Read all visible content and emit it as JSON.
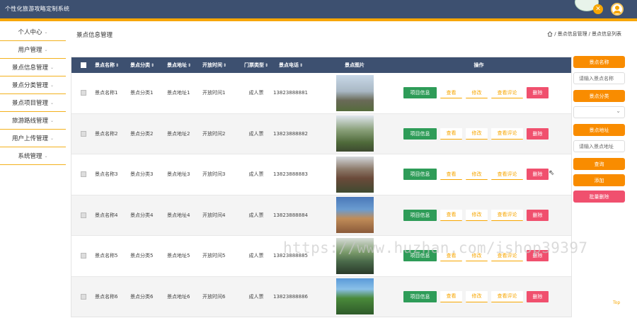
{
  "header": {
    "app_title": "个性化旅游攻略定制系统"
  },
  "sidebar": {
    "items": [
      {
        "label": "个人中心"
      },
      {
        "label": "用户管理"
      },
      {
        "label": "景点信息管理"
      },
      {
        "label": "景点分类管理"
      },
      {
        "label": "景点项目管理"
      },
      {
        "label": "旅游路线管理"
      },
      {
        "label": "用户上传管理"
      },
      {
        "label": "系统管理"
      }
    ]
  },
  "page": {
    "title": "景点信息管理",
    "breadcrumb": [
      "景点信息管理",
      "景点信息列表"
    ]
  },
  "table": {
    "headers": {
      "name": "景点名称",
      "category": "景点分类",
      "address": "景点地址",
      "open_time": "开放时间",
      "ticket": "门票类型",
      "phone": "景点电话",
      "image": "景点图片",
      "ops": "操作"
    },
    "actions": {
      "project": "项目信息",
      "view": "查看",
      "edit": "修改",
      "reviews": "查看评论",
      "delete": "删除"
    },
    "rows": [
      {
        "name": "景点名称1",
        "category": "景点分类1",
        "address": "景点地址1",
        "open_time": "开放时间1",
        "ticket": "成人票",
        "phone": "13823888881"
      },
      {
        "name": "景点名称2",
        "category": "景点分类2",
        "address": "景点地址2",
        "open_time": "开放时间2",
        "ticket": "成人票",
        "phone": "13823888882"
      },
      {
        "name": "景点名称3",
        "category": "景点分类3",
        "address": "景点地址3",
        "open_time": "开放时间3",
        "ticket": "成人票",
        "phone": "13823888883"
      },
      {
        "name": "景点名称4",
        "category": "景点分类4",
        "address": "景点地址4",
        "open_time": "开放时间4",
        "ticket": "成人票",
        "phone": "13823888884"
      },
      {
        "name": "景点名称5",
        "category": "景点分类5",
        "address": "景点地址5",
        "open_time": "开放时间5",
        "ticket": "成人票",
        "phone": "13823888885"
      },
      {
        "name": "景点名称6",
        "category": "景点分类6",
        "address": "景点地址6",
        "open_time": "开放时间6",
        "ticket": "成人票",
        "phone": "13823888886"
      }
    ]
  },
  "search_panel": {
    "name_label": "景点名称",
    "name_placeholder": "请输入景点名称",
    "category_label": "景点分类",
    "address_label": "景点地址",
    "address_placeholder": "请输入景点地址",
    "search_button": "查询",
    "add_button": "添加",
    "batch_delete_button": "批量删除"
  },
  "footer": {
    "top_link": "Top"
  },
  "watermark": "https://www.huzhan.com/ishop39397",
  "colors": {
    "header": "#3d5070",
    "accent": "#f7a600",
    "green": "#2e9c58",
    "red": "#f0506e"
  }
}
